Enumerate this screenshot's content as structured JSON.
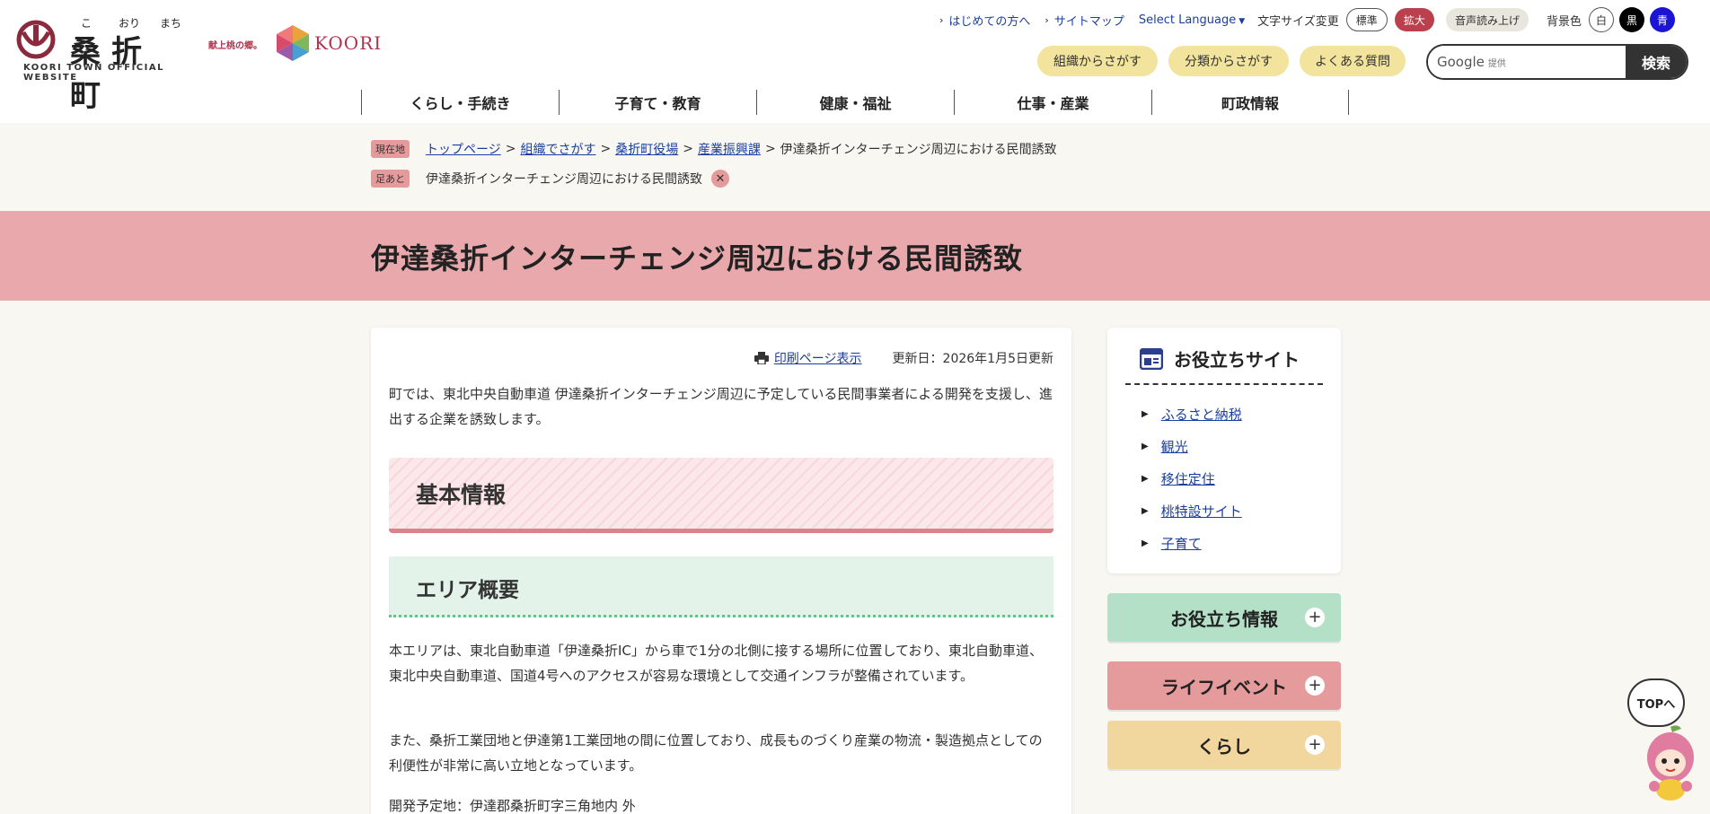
{
  "header": {
    "logo": {
      "kana": [
        "こ",
        "おり",
        "まち"
      ],
      "name": "桑折町",
      "sub": "KOORI TOWN OFFICIAL WEBSITE"
    },
    "brand": {
      "tagline": "献上桃の郷。",
      "name": "KOORI"
    },
    "util_links": [
      "はじめての方へ",
      "サイトマップ"
    ],
    "language": "Select Language",
    "font_size": {
      "label": "文字サイズ変更",
      "standard": "標準",
      "large": "拡大"
    },
    "voice": "音声読み上げ",
    "bg_color": {
      "label": "背景色",
      "white": "白",
      "black": "黒",
      "blue": "青"
    },
    "search_buttons": [
      "組織からさがす",
      "分類からさがす",
      "よくある質問"
    ],
    "search": {
      "google": "Google",
      "provided": "提供",
      "submit": "検索"
    },
    "gnav": [
      "くらし・手続き",
      "子育て・教育",
      "健康・福祉",
      "仕事・産業",
      "町政情報"
    ]
  },
  "breadcrumb": {
    "current_tag": "現在地",
    "trail": [
      "トップページ",
      "組織でさがす",
      "桑折町役場",
      "産業振興課"
    ],
    "current": "伊達桑折インターチェンジ周辺における民間誘致",
    "footprint_tag": "足あと",
    "footprint": "伊達桑折インターチェンジ周辺における民間誘致",
    "close": "✕"
  },
  "page": {
    "title": "伊達桑折インターチェンジ周辺における民間誘致"
  },
  "article": {
    "print": "印刷ページ表示",
    "updated": "更新日：2026年1月5日更新",
    "intro": "町では、東北中央自動車道 伊達桑折インターチェンジ周辺に予定している民間事業者による開発を支援し、進出する企業を誘致します。",
    "h2": "基本情報",
    "h3": "エリア概要",
    "para1": "本エリアは、東北自動車道「伊達桑折IC」から車で1分の北側に接する場所に位置しており、東北自動車道、東北中央自動車道、国道4号へのアクセスが容易な環境として交通インフラが整備されています。",
    "para2": "また、桑折工業団地と伊達第1工業団地の間に位置しており、成長ものづくり産業の物流・製造拠点としての利便性が非常に高い立地となっています。",
    "para3": "開発予定地：伊達郡桑折町字三角地内 外"
  },
  "sidebar": {
    "title": "お役立ちサイト",
    "links": [
      "ふるさと納税",
      "観光",
      "移住定住",
      "桃特設サイト",
      "子育て"
    ],
    "accordions": [
      "お役立ち情報",
      "ライフイベント",
      "くらし"
    ],
    "plus": "+"
  },
  "top_button": "TOPへ",
  "colors": {
    "brand": "#b0334c",
    "title_band": "#e9a8ab",
    "link": "#1a3f9e",
    "green": "#b4e0c7",
    "pink": "#e59a9c",
    "yellow": "#f1d79e"
  }
}
